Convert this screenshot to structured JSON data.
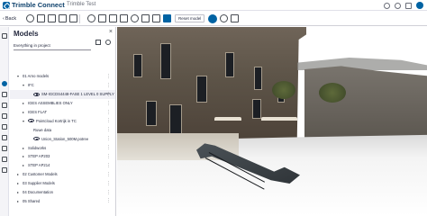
{
  "app": {
    "brand": "Trimble Connect",
    "project": "Trimble Test",
    "accent_color": "#0063a3",
    "top_icons": [
      "help-icon",
      "notifications-icon",
      "apps-icon",
      "user-avatar"
    ]
  },
  "toolbar": {
    "back_label": "Back",
    "reset_label": "Reset model",
    "icons_left": [
      "orbit-icon",
      "select-icon",
      "box-select-icon",
      "crop-icon",
      "fit-icon"
    ],
    "icons_mid": [
      "section-box-icon",
      "zoom-fit-icon",
      "clip-plane-icon",
      "measure-icon",
      "markup-icon",
      "annotation-icon",
      "view-3d-icon",
      "visibility-icon"
    ],
    "icons_right": [
      "info-icon",
      "settings-icon",
      "share-icon"
    ]
  },
  "panel": {
    "title": "Models",
    "filter_value": "Everything in project",
    "tree": [
      {
        "label": "01 Arno models",
        "level": 0,
        "expanded": true,
        "eye": false
      },
      {
        "label": "IFC",
        "level": 1,
        "expanded": true,
        "eye": false
      },
      {
        "label": "SM-IGCDS4448-FASE 1 LEVEL 0 SUPPLY L...",
        "level": 2,
        "expanded": false,
        "eye": true,
        "highlight": true
      },
      {
        "label": "IGES ASSEMBLIES ONLY",
        "level": 1,
        "expanded": false,
        "eye": false
      },
      {
        "label": "IGES FLAT",
        "level": 1,
        "expanded": false,
        "eye": false
      },
      {
        "label": "Pointcloud Kortrijk in TC",
        "level": 1,
        "expanded": true,
        "eye": true
      },
      {
        "label": "Ruwe data",
        "level": 2,
        "expanded": false,
        "eye": false
      },
      {
        "label": "Union_Station_500M.potree",
        "level": 2,
        "expanded": false,
        "eye": true
      },
      {
        "label": "Solidworks",
        "level": 1,
        "expanded": false,
        "eye": false
      },
      {
        "label": "STEP AP203",
        "level": 1,
        "expanded": false,
        "eye": false
      },
      {
        "label": "STEP AP214",
        "level": 1,
        "expanded": false,
        "eye": false
      },
      {
        "label": "02 Customer Models",
        "level": 0,
        "expanded": false,
        "eye": false
      },
      {
        "label": "03 Supplier Models",
        "level": 0,
        "expanded": false,
        "eye": false
      },
      {
        "label": "04 Documentation",
        "level": 0,
        "expanded": false,
        "eye": false
      },
      {
        "label": "05 Shared",
        "level": 0,
        "expanded": false,
        "eye": false
      }
    ]
  },
  "rail_icons": [
    "info-icon",
    "models-icon",
    "layers-icon",
    "link-icon",
    "folder-icon",
    "views-icon",
    "check-icon",
    "clash-icon",
    "list-icon",
    "settings-icon"
  ]
}
